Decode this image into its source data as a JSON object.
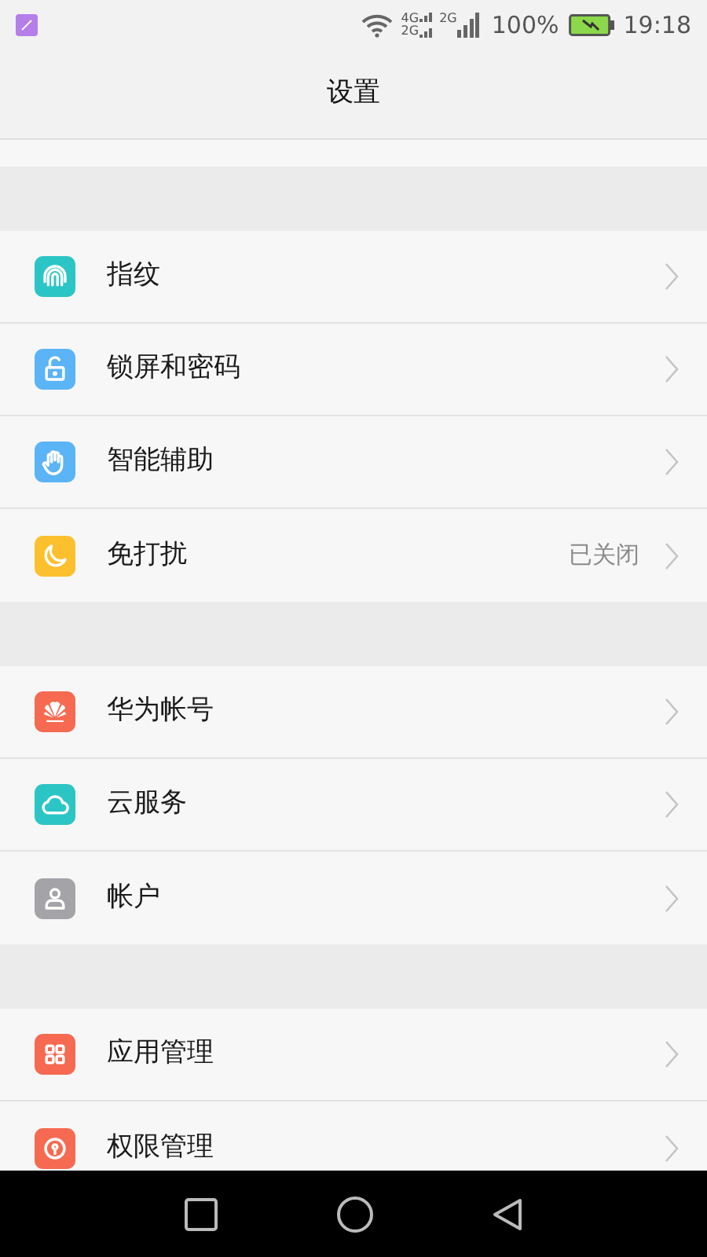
{
  "status_bar": {
    "network_labels": [
      "4G",
      "2G",
      "2G"
    ],
    "battery_percent": "100%",
    "time": "19:18"
  },
  "header": {
    "title": "设置"
  },
  "groups": [
    {
      "items": [
        {
          "label": "指纹",
          "color": "#2cc5c5"
        },
        {
          "label": "锁屏和密码",
          "color": "#5ab4f5"
        },
        {
          "label": "智能辅助",
          "color": "#5ab4f5"
        },
        {
          "label": "免打扰",
          "color": "#fcc02e",
          "value": "已关闭"
        }
      ]
    },
    {
      "items": [
        {
          "label": "华为帐号",
          "color": "#f56a51"
        },
        {
          "label": "云服务",
          "color": "#2cc5c5"
        },
        {
          "label": "帐户",
          "color": "#a3a3a8"
        }
      ]
    },
    {
      "items": [
        {
          "label": "应用管理",
          "color": "#f56a51"
        },
        {
          "label": "权限管理",
          "color": "#f56a51"
        }
      ]
    }
  ]
}
